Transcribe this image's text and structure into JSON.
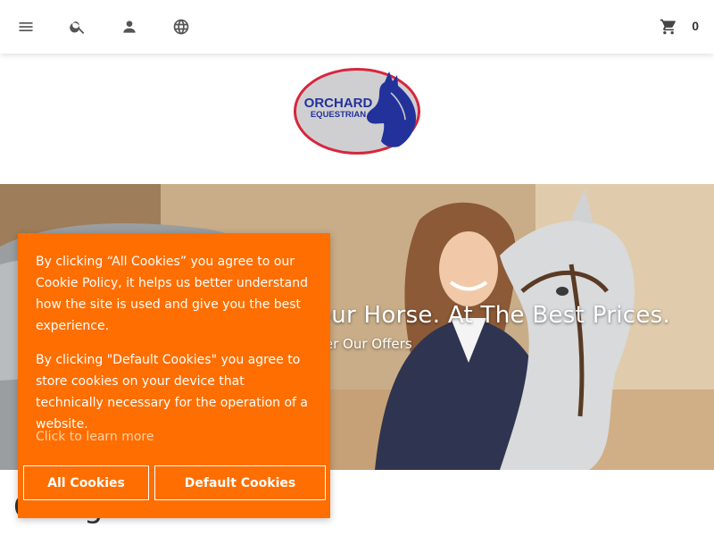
{
  "header": {
    "menu_icon": "menu-icon",
    "search_icon": "search-icon",
    "account_icon": "user-icon",
    "language_icon": "globe-icon",
    "cart_icon": "cart-icon",
    "cart_count": "0"
  },
  "logo": {
    "line1": "ORCHARD",
    "line2": "EQUESTRIAN"
  },
  "hero": {
    "title": "our Horse. At The Best Prices.",
    "subtitle": "ver Our Offers"
  },
  "categories_heading": "Categories",
  "cookie": {
    "text_all": "By clicking “All Cookies” you agree to our Cookie Policy, it helps us better understand how the site is used and give you the best experience.",
    "text_default": "By clicking \"Default Cookies\" you agree to store cookies on your device that technically necessary for the operation of a website.",
    "learn_more": "Click to learn more",
    "btn_all": "All Cookies",
    "btn_default": "Default Cookies"
  },
  "colors": {
    "cookie_bg": "#ff6e00",
    "logo_red": "#d7263d",
    "logo_blue": "#23329a"
  }
}
